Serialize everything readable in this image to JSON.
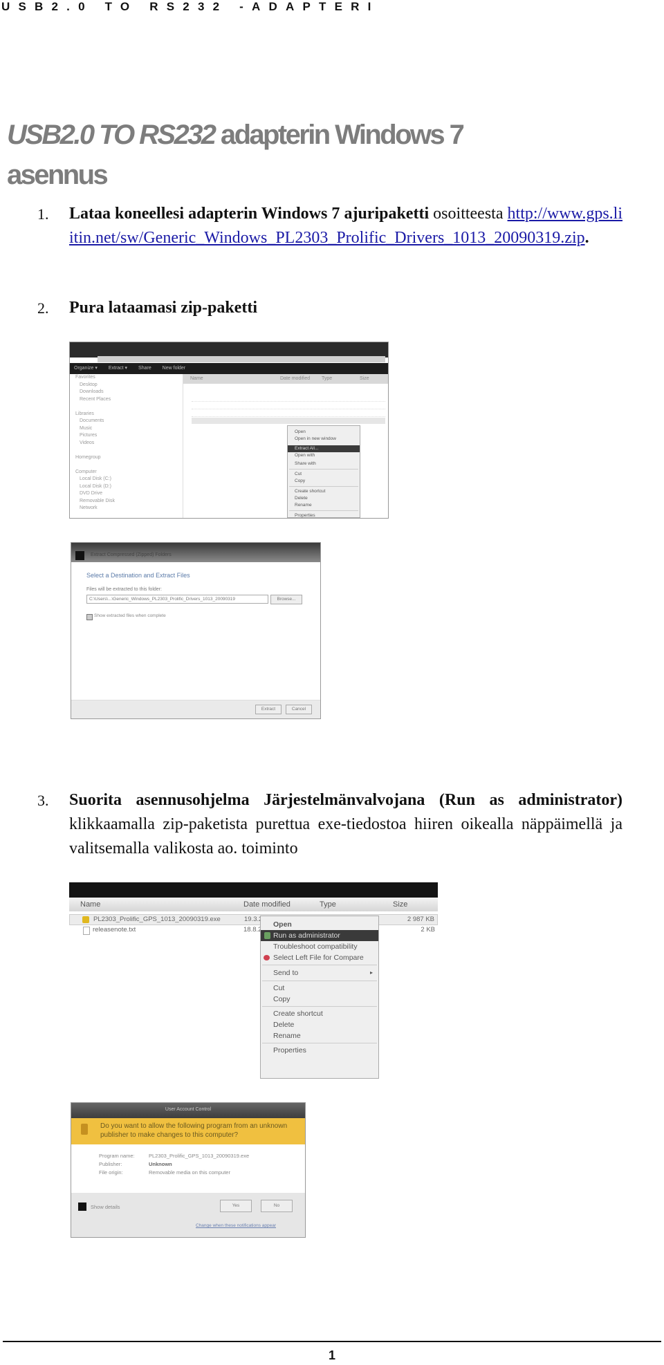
{
  "header": {
    "running_title": "USB2.0 TO RS232 -ADAPTERI"
  },
  "title": {
    "italic_part": "USB2.0 TO RS232",
    "rest_line1": " adapterin Windows 7",
    "line2": "asennus"
  },
  "steps": [
    {
      "number": "1.",
      "bold": "Lataa koneellesi adapterin Windows 7 ajuripaketti",
      "text": " osoitteesta ",
      "link": "http://www.gps.liitin.net/sw/Generic_Windows_PL2303_Prolific_Drivers_1013_20090319.zip",
      "after_link": "."
    },
    {
      "number": "2.",
      "bold": "Pura lataamasi zip-paketti"
    },
    {
      "number": "3.",
      "bold": "Suorita asennusohjelma Järjestelmänvalvojana (Run as administrator)",
      "text": " klikkaamalla zip-paketista purettua exe-tiedostoa hiiren oikealla näppäimellä ja valitsemalla valikosta ao. toiminto"
    }
  ],
  "screenshot_explorer": {
    "toolbar": [
      "Organize ▾",
      "Extract ▾",
      "Share",
      "New folder"
    ],
    "nav": [
      "Favorites",
      "Desktop",
      "Downloads",
      "Recent Places",
      "",
      "Libraries",
      "Documents",
      "Music",
      "Pictures",
      "Videos",
      "",
      "Homegroup",
      "",
      "Computer",
      "Local Disk (C:)",
      "Local Disk (D:)",
      "DVD Drive",
      "Removable Disk",
      "Network"
    ],
    "columns": [
      "Name",
      "Date modified",
      "Type",
      "Size"
    ],
    "context_menu": [
      "Open",
      "Open in new window",
      "Extract All...",
      "Open with",
      "Share with",
      "Cut",
      "Copy",
      "Create shortcut",
      "Delete",
      "Rename",
      "Properties"
    ]
  },
  "screenshot_extract": {
    "title": "Extract Compressed (Zipped) Folders",
    "heading": "Select a Destination and Extract Files",
    "label": "Files will be extracted to this folder:",
    "path": "C:\\Users\\...\\Generic_Windows_PL2303_Prolific_Drivers_1013_20090319",
    "browse": "Browse...",
    "checkbox": "Show extracted files when complete",
    "extract": "Extract",
    "cancel": "Cancel"
  },
  "screenshot_runas": {
    "columns": [
      "Name",
      "Date modified",
      "Type",
      "Size"
    ],
    "files": [
      {
        "name": "PL2303_Prolific_GPS_1013_20090319.exe",
        "date": "19.3.2009",
        "size": "2 987 KB"
      },
      {
        "name": "releasenote.txt",
        "date": "18.8.2",
        "size": "2 KB"
      }
    ],
    "context_menu": [
      "Open",
      "Run as administrator",
      "Troubleshoot compatibility",
      "Select Left File for Compare",
      "Send to",
      "Cut",
      "Copy",
      "Create shortcut",
      "Delete",
      "Rename",
      "Properties"
    ]
  },
  "screenshot_uac": {
    "title": "User Account Control",
    "question": "Do you want to allow the following program from an unknown publisher to make changes to this computer?",
    "program_label": "Program name:",
    "program_value": "PL2303_Prolific_GPS_1013_20090319.exe",
    "publisher_label": "Publisher:",
    "publisher_value": "Unknown",
    "origin_label": "File origin:",
    "origin_value": "Removable media on this computer",
    "details": "Show details",
    "yes": "Yes",
    "no": "No",
    "link": "Change when these notifications appear"
  },
  "footer": {
    "page_number": "1"
  }
}
